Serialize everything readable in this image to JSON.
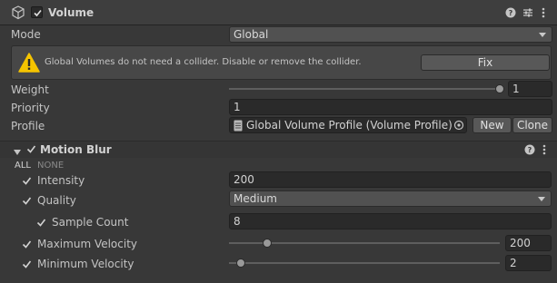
{
  "component": {
    "title": "Volume",
    "enabled": true,
    "icons": [
      "cube-icon",
      "help-icon",
      "preset-icon",
      "more-icon"
    ]
  },
  "fields": {
    "mode": {
      "label": "Mode",
      "value": "Global"
    },
    "help": {
      "message": "Global Volumes do not need a collider. Disable or remove the collider.",
      "fix_label": "Fix"
    },
    "weight": {
      "label": "Weight",
      "value": "1",
      "fraction": 1.0
    },
    "priority": {
      "label": "Priority",
      "value": "1"
    },
    "profile": {
      "label": "Profile",
      "value": "Global Volume Profile (Volume Profile)",
      "new_label": "New",
      "clone_label": "Clone"
    }
  },
  "override": {
    "title": "Motion Blur",
    "enabled": true,
    "toggle_all": "ALL",
    "toggle_none": "NONE",
    "intensity": {
      "label": "Intensity",
      "value": "200",
      "overridden": true
    },
    "quality": {
      "label": "Quality",
      "value": "Medium",
      "overridden": true
    },
    "sample_count": {
      "label": "Sample Count",
      "value": "8",
      "overridden": true
    },
    "max_velocity": {
      "label": "Maximum Velocity",
      "value": "200",
      "overridden": true,
      "fraction": 0.14
    },
    "min_velocity": {
      "label": "Minimum Velocity",
      "value": "2",
      "overridden": true,
      "fraction": 0.045
    }
  },
  "colors": {
    "background": "#383838",
    "warning": "#f5c400",
    "field": "#2a2a2a",
    "button": "#585858"
  }
}
